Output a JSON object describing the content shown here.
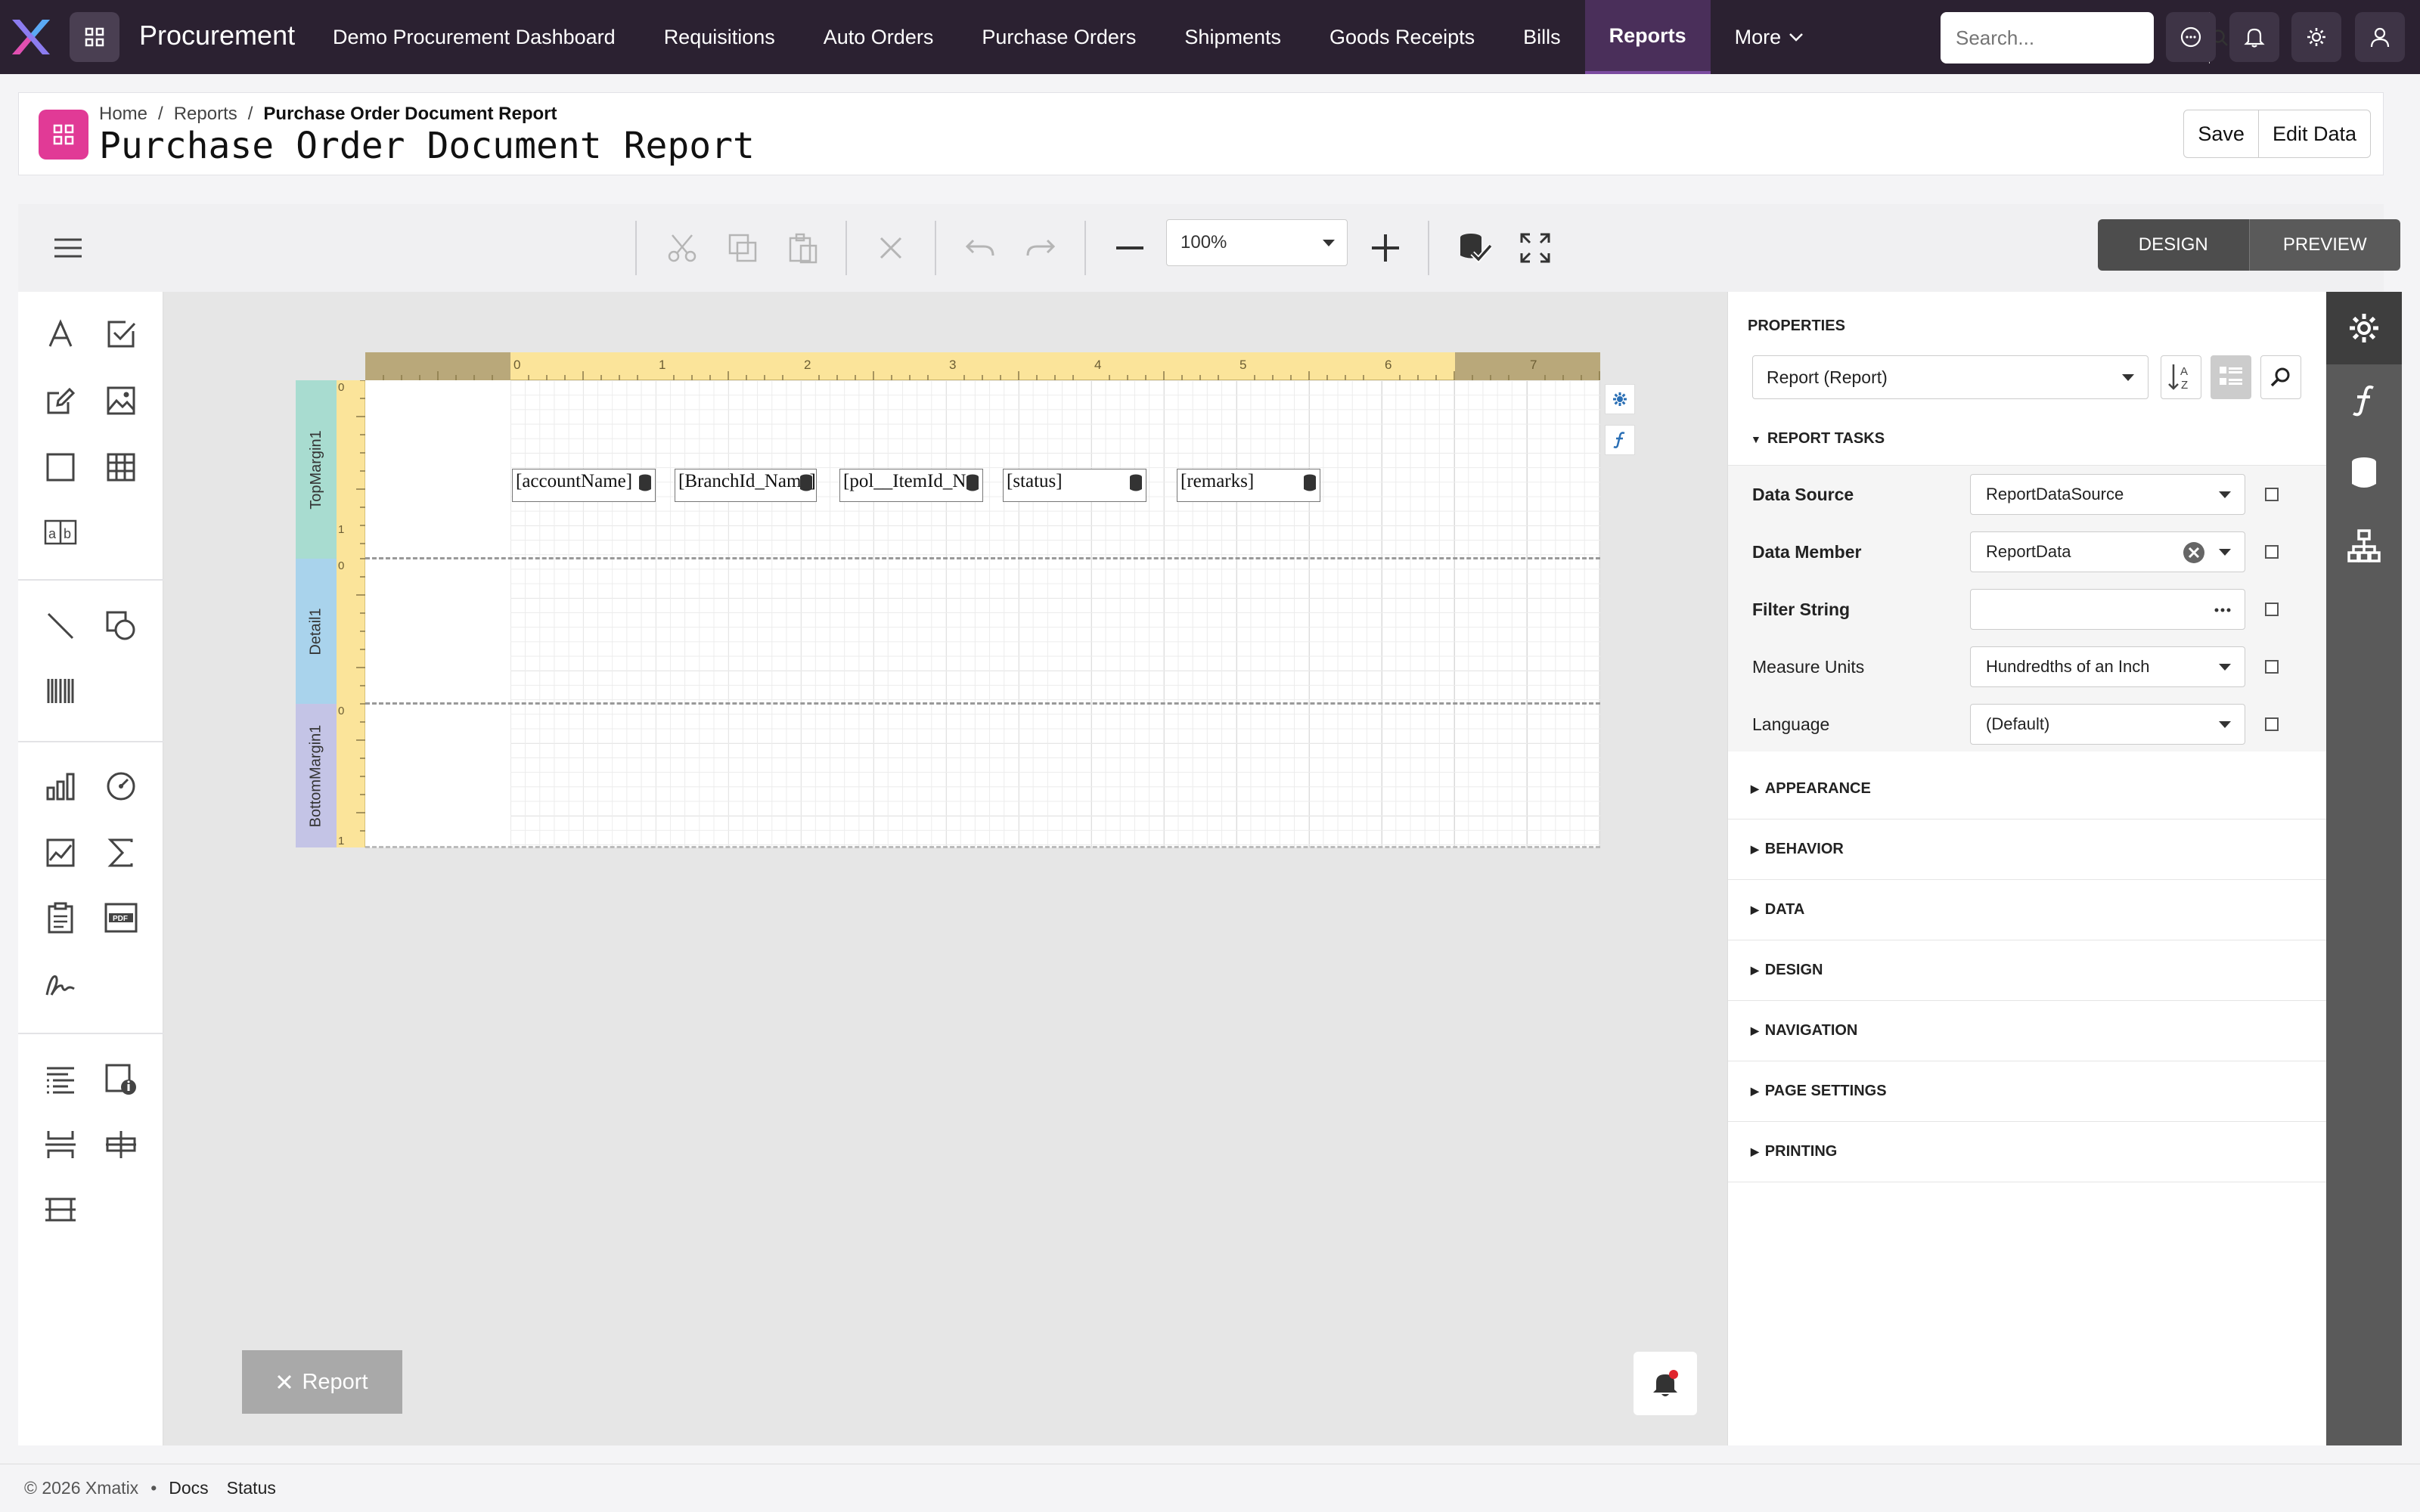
{
  "app": {
    "name": "Procurement"
  },
  "nav": {
    "items": [
      "Demo Procurement Dashboard",
      "Requisitions",
      "Auto Orders",
      "Purchase Orders",
      "Shipments",
      "Goods Receipts",
      "Bills",
      "Reports"
    ],
    "more": "More",
    "active": "Reports"
  },
  "search": {
    "placeholder": "Search..."
  },
  "breadcrumb": {
    "home": "Home",
    "sep": "/",
    "reports": "Reports",
    "current": "Purchase Order Document Report"
  },
  "page": {
    "title": "Purchase Order Document Report"
  },
  "header_actions": {
    "save": "Save",
    "edit_data": "Edit Data"
  },
  "designer": {
    "zoom": "100%",
    "mode": {
      "design": "DESIGN",
      "preview": "PREVIEW"
    },
    "ruler_ticks": [
      "0",
      "1",
      "2",
      "3",
      "4",
      "5",
      "6",
      "7"
    ],
    "vruler_ticks": [
      "0",
      "1",
      "0",
      "0",
      "1"
    ],
    "bands": {
      "top": "TopMargin1",
      "detail": "Detail1",
      "bottom": "BottomMargin1"
    },
    "fields": [
      "[accountName]",
      "[BranchId_Name]",
      "[pol__ItemId_N",
      "[status]",
      "[remarks]"
    ],
    "report_tab": "Report"
  },
  "properties": {
    "title": "PROPERTIES",
    "object": "Report (Report)",
    "tasks_title": "REPORT TASKS",
    "rows": [
      {
        "label": "Data Source",
        "value": "ReportDataSource"
      },
      {
        "label": "Data Member",
        "value": "ReportData"
      },
      {
        "label": "Filter String",
        "value": ""
      },
      {
        "label": "Measure Units",
        "value": "Hundredths of an Inch"
      },
      {
        "label": "Language",
        "value": "(Default)"
      }
    ],
    "sections": [
      "APPEARANCE",
      "BEHAVIOR",
      "DATA",
      "DESIGN",
      "NAVIGATION",
      "PAGE SETTINGS",
      "PRINTING"
    ]
  },
  "footer": {
    "copyright": "© 2026 Xmatix",
    "dot": "•",
    "docs": "Docs",
    "status": "Status"
  },
  "colors": {
    "topbar": "#2b2131",
    "accent": "#e13a96",
    "ruler": "#fbe49a",
    "band_top": "#a8dcd0",
    "band_detail": "#a9d3ec",
    "band_bottom": "#c4c4e6"
  }
}
